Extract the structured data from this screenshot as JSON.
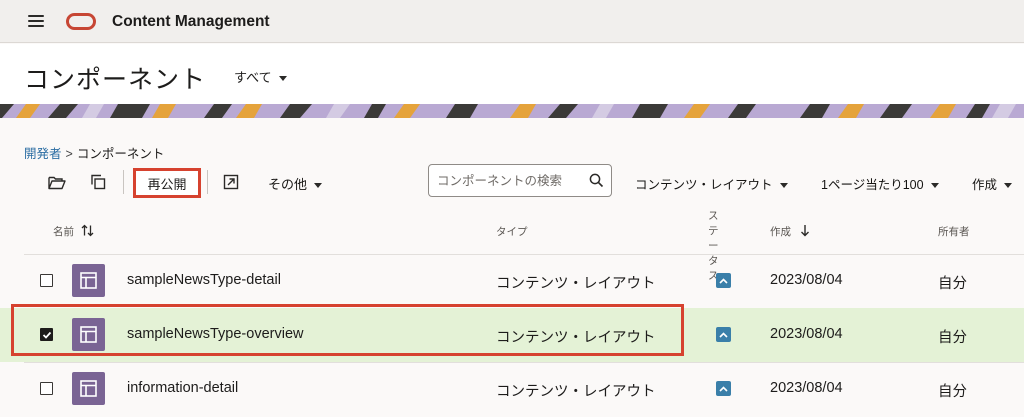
{
  "header": {
    "app_title": "Content Management",
    "menu_icon": "hamburger-menu-icon",
    "logo_icon": "oracle-logo-icon",
    "logo_color": "#c74634"
  },
  "page": {
    "title": "コンポーネント",
    "filter_label": "すべて"
  },
  "breadcrumb": {
    "parent": "開発者",
    "separator": ">",
    "current": "コンポーネント"
  },
  "toolbar": {
    "open_icon": "folder-open-icon",
    "copy_icon": "copy-icon",
    "republish_label": "再公開",
    "export_icon": "external-link-icon",
    "more_label": "その他",
    "search_placeholder": "コンポーネントの検索",
    "search_icon": "search-icon",
    "type_filter_label": "コンテンツ・レイアウト",
    "per_page_label": "1ページ当たり100",
    "create_label": "作成"
  },
  "table": {
    "headers": {
      "name": "名前",
      "type": "タイプ",
      "status": "ステータス",
      "created": "作成",
      "owner": "所有者"
    },
    "rows": [
      {
        "name": "sampleNewsType-detail",
        "type": "コンテンツ・レイアウト",
        "created": "2023/08/04",
        "owner": "自分",
        "checked": false
      },
      {
        "name": "sampleNewsType-overview",
        "type": "コンテンツ・レイアウト",
        "created": "2023/08/04",
        "owner": "自分",
        "checked": true
      },
      {
        "name": "information-detail",
        "type": "コンテンツ・レイアウト",
        "created": "2023/08/04",
        "owner": "自分",
        "checked": false
      }
    ]
  },
  "colors": {
    "accent_highlight": "#d6422f",
    "selected_row": "#e4f2d6",
    "thumbnail": "#7a6494",
    "status_icon": "#3a7fa9",
    "link": "#2c6ea3"
  }
}
